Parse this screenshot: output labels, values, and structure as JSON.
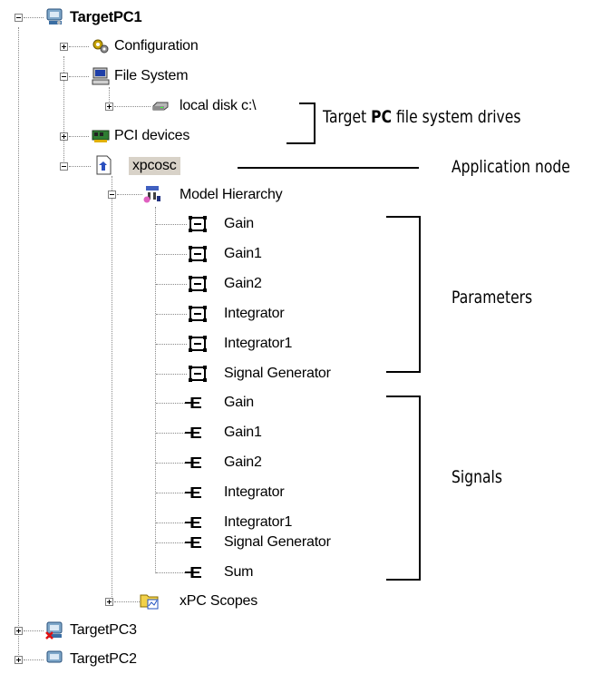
{
  "tree": {
    "root": "TargetPC1",
    "configuration": "Configuration",
    "file_system": "File System",
    "local_disk": "local disk c:\\",
    "pci_devices": "PCI devices",
    "app_node": "xpcosc",
    "model_hierarchy": "Model Hierarchy",
    "parameters": [
      "Gain",
      "Gain1",
      "Gain2",
      "Integrator",
      "Integrator1",
      "Signal Generator"
    ],
    "signals": [
      "Gain",
      "Gain1",
      "Gain2",
      "Integrator",
      "Integrator1",
      "Signal Generator",
      "Sum"
    ],
    "xpc_scopes": "xPC Scopes",
    "target3": "TargetPC3",
    "target2": "TargetPC2"
  },
  "annotations": {
    "drives_prefix": "Target ",
    "drives_bold": "PC",
    "drives_suffix": " file system drives",
    "application_node": "Application node",
    "parameters": "Parameters",
    "signals": "Signals"
  }
}
